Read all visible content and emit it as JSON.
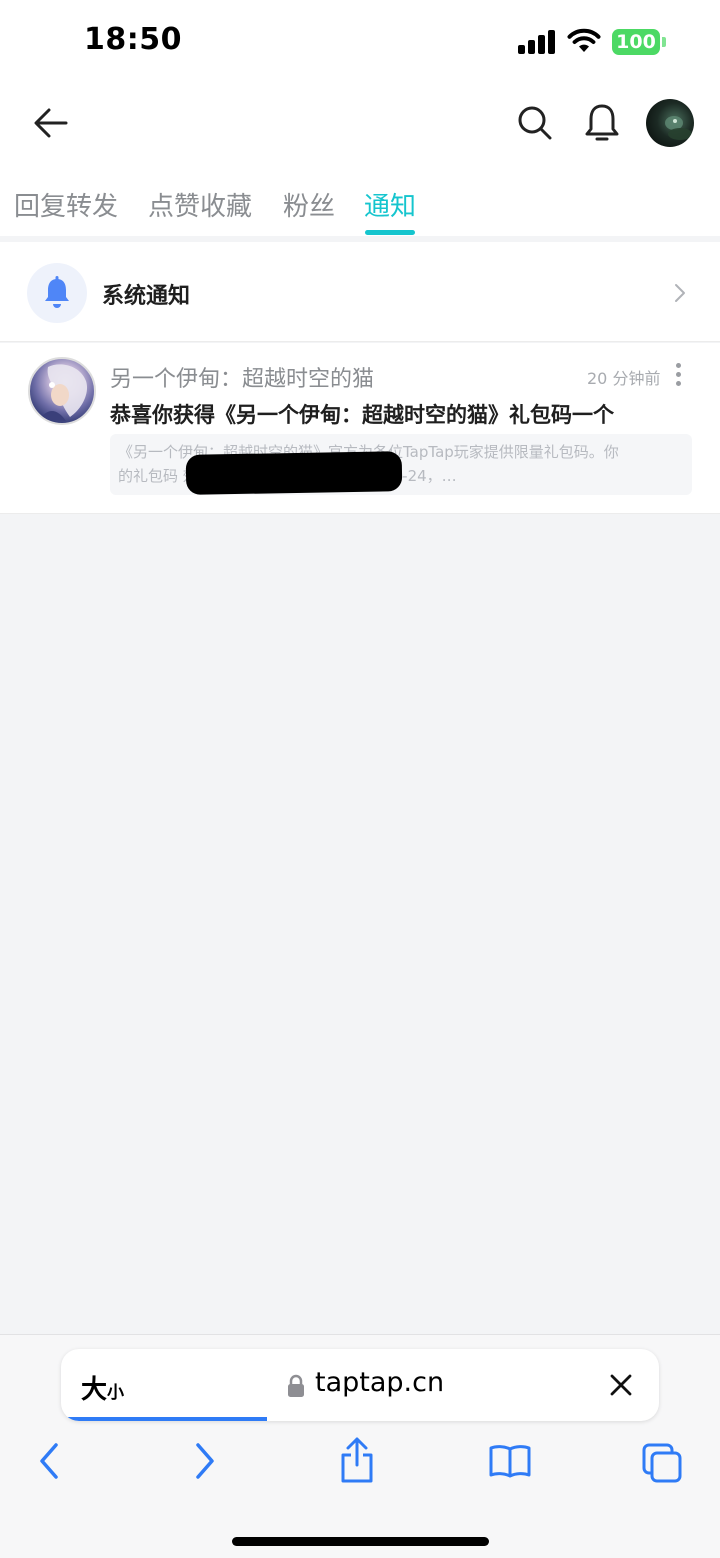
{
  "status_bar": {
    "time": "18:50",
    "battery": "100"
  },
  "tabs": [
    {
      "label": "回复转发",
      "active": false
    },
    {
      "label": "点赞收藏",
      "active": false
    },
    {
      "label": "粉丝",
      "active": false
    },
    {
      "label": "通知",
      "active": true
    }
  ],
  "system_notice": {
    "label": "系统通知"
  },
  "notification": {
    "source": "另一个伊甸：超越时空的猫",
    "time": "20 分钟前",
    "title": "恭喜你获得《另一个伊甸：超越时空的猫》礼包码一个",
    "body_line1": "《另一个伊甸：超越时空的猫》官方为各位TapTap玩家提供限量礼包码。你",
    "body_line2": "的礼包码                                          效期：2023-05-10 至 2023-05-24，…"
  },
  "browser": {
    "text_size_label_big": "大",
    "text_size_label_small": "小",
    "url": "taptap.cn"
  },
  "colors": {
    "accent": "#15c5ce",
    "bell": "#4f86f7",
    "browser_blue": "#2f7bf6"
  },
  "icons": [
    "back-arrow-icon",
    "search-icon",
    "bell-icon",
    "chevron-right-icon",
    "more-vertical-icon",
    "lock-icon",
    "close-icon",
    "share-icon",
    "bookmarks-icon",
    "tabs-icon"
  ]
}
